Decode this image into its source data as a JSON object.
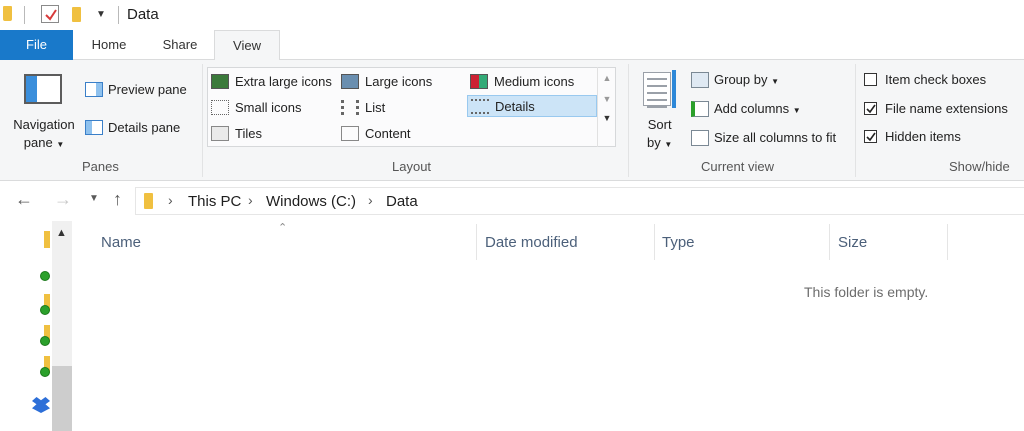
{
  "window": {
    "title": "Data"
  },
  "tabs": [
    {
      "label": "File"
    },
    {
      "label": "Home"
    },
    {
      "label": "Share"
    },
    {
      "label": "View"
    }
  ],
  "ribbon": {
    "panes": {
      "group_label": "Panes",
      "navigation_pane": "Navigation",
      "navigation_pane_line2": "pane",
      "preview_pane": "Preview pane",
      "details_pane": "Details pane"
    },
    "layout": {
      "group_label": "Layout",
      "items": [
        {
          "label": "Extra large icons",
          "icon": "extra-large-icons-icon"
        },
        {
          "label": "Large icons",
          "icon": "large-icons-icon"
        },
        {
          "label": "Medium icons",
          "icon": "medium-icons-icon"
        },
        {
          "label": "Small icons",
          "icon": "small-icons-icon"
        },
        {
          "label": "List",
          "icon": "list-icon"
        },
        {
          "label": "Details",
          "icon": "details-icon",
          "selected": true
        },
        {
          "label": "Tiles",
          "icon": "tiles-icon"
        },
        {
          "label": "Content",
          "icon": "content-icon"
        }
      ]
    },
    "current_view": {
      "group_label": "Current view",
      "sort_by": "Sort",
      "sort_by_line2": "by",
      "group_by": "Group by",
      "add_columns": "Add columns",
      "size_all_columns": "Size all columns to fit"
    },
    "show_hide": {
      "group_label": "Show/hide",
      "item_check_boxes": {
        "label": "Item check boxes",
        "checked": false
      },
      "file_name_extensions": {
        "label": "File name extensions",
        "checked": true
      },
      "hidden_items": {
        "label": "Hidden items",
        "checked": true
      }
    }
  },
  "address": {
    "breadcrumbs": [
      "This PC",
      "Windows (C:)",
      "Data"
    ]
  },
  "file_list": {
    "columns": [
      "Name",
      "Date modified",
      "Type",
      "Size"
    ],
    "empty_message": "This folder is empty."
  },
  "colors": {
    "file_tab": "#1979ca",
    "selection": "#cce4f7",
    "folder": "#f0c040"
  }
}
